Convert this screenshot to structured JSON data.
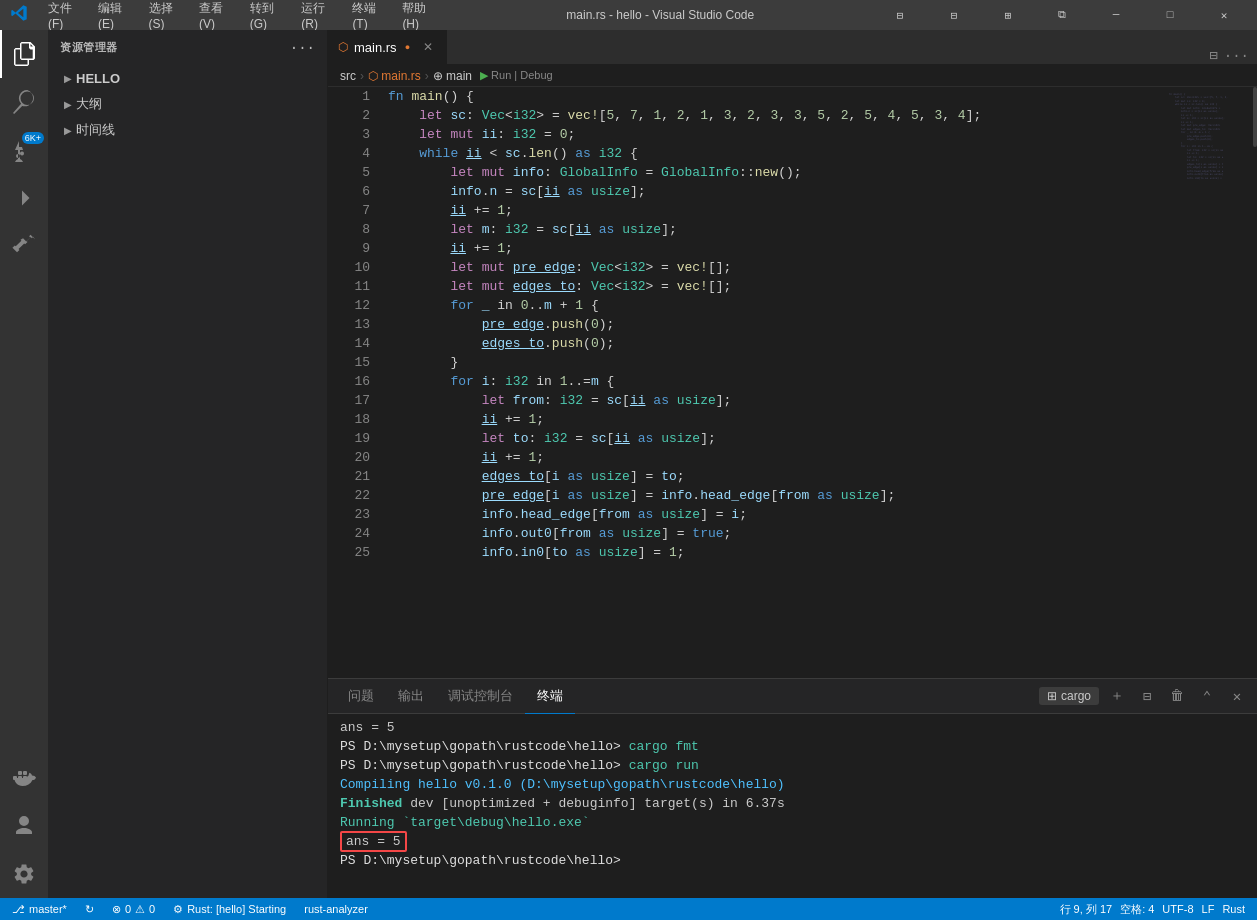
{
  "titlebar": {
    "title": "main.rs - hello - Visual Studio Code",
    "menu": [
      "文件(F)",
      "编辑(E)",
      "选择(S)",
      "查看(V)",
      "转到(G)",
      "运行(R)",
      "终端(T)",
      "帮助(H)"
    ]
  },
  "sidebar": {
    "title": "资源管理器",
    "items": [
      {
        "label": "HELLO",
        "expanded": true
      },
      {
        "label": "大纲",
        "expanded": false
      },
      {
        "label": "时间线",
        "expanded": false
      }
    ]
  },
  "tabs": [
    {
      "label": "main.rs",
      "modified": true,
      "active": true
    }
  ],
  "breadcrumb": {
    "parts": [
      "src",
      "main.rs",
      "main"
    ],
    "runDebug": "Run | Debug"
  },
  "code": {
    "lines": [
      {
        "n": 1,
        "text": "fn main() {"
      },
      {
        "n": 2,
        "text": "    let sc: Vec<i32> = vec![5, 7, 1, 2, 1, 3, 2, 3, 3, 5, 2, 5, 4, 5, 3, 4];"
      },
      {
        "n": 3,
        "text": "    let mut ii: i32 = 0;"
      },
      {
        "n": 4,
        "text": "    while ii < sc.len() as i32 {"
      },
      {
        "n": 5,
        "text": "        let mut info: GlobalInfo = GlobalInfo::new();"
      },
      {
        "n": 6,
        "text": "        info.n = sc[ii as usize];"
      },
      {
        "n": 7,
        "text": "        ii += 1;"
      },
      {
        "n": 8,
        "text": "        let m: i32 = sc[ii as usize];"
      },
      {
        "n": 9,
        "text": "        ii += 1;"
      },
      {
        "n": 10,
        "text": "        let mut pre_edge: Vec<i32> = vec![];"
      },
      {
        "n": 11,
        "text": "        let mut edges_to: Vec<i32> = vec![];"
      },
      {
        "n": 12,
        "text": "        for _ in 0..m + 1 {"
      },
      {
        "n": 13,
        "text": "            pre_edge.push(0);"
      },
      {
        "n": 14,
        "text": "            edges_to.push(0);"
      },
      {
        "n": 15,
        "text": "        }"
      },
      {
        "n": 16,
        "text": "        for i: i32 in 1..=m {"
      },
      {
        "n": 17,
        "text": "            let from: i32 = sc[ii as usize];"
      },
      {
        "n": 18,
        "text": "            ii += 1;"
      },
      {
        "n": 19,
        "text": "            let to: i32 = sc[ii as usize];"
      },
      {
        "n": 20,
        "text": "            ii += 1;"
      },
      {
        "n": 21,
        "text": "            edges_to[i as usize] = to;"
      },
      {
        "n": 22,
        "text": "            pre_edge[i as usize] = info.head_edge[from as usize];"
      },
      {
        "n": 23,
        "text": "            info.head_edge[from as usize] = i;"
      },
      {
        "n": 24,
        "text": "            info.out0[from as usize] = true;"
      },
      {
        "n": 25,
        "text": "            info.in0[to as usize] = 1;"
      }
    ]
  },
  "panel": {
    "tabs": [
      "问题",
      "输出",
      "调试控制台",
      "终端"
    ],
    "active_tab": "终端",
    "cargo_label": "cargo",
    "terminal_lines": [
      {
        "type": "plain",
        "text": "ans = 5"
      },
      {
        "type": "prompt",
        "text": "PS D:\\mysetup\\gopath\\rustcode\\hello> ",
        "cmd": "cargo fmt"
      },
      {
        "type": "prompt",
        "text": "PS D:\\mysetup\\gopath\\rustcode\\hello> ",
        "cmd": "cargo run"
      },
      {
        "type": "compiling",
        "text": "   Compiling hello v0.1.0 (D:\\mysetup\\gopath\\rustcode\\hello)"
      },
      {
        "type": "finished",
        "text": "    Finished dev [unoptimized + debuginfo] target(s) in 6.37s"
      },
      {
        "type": "running",
        "text": "     Running `target\\debug\\hello.exe`"
      },
      {
        "type": "highlight",
        "text": "ans = 5"
      },
      {
        "type": "prompt_cursor",
        "text": "PS D:\\mysetup\\gopath\\rustcode\\hello> "
      }
    ]
  },
  "statusbar": {
    "branch": "master*",
    "sync": "",
    "errors": "0",
    "warnings": "0",
    "rust_info": "Rust: [hello] Starting",
    "analyzer": "rust-analyzer",
    "position": "行 9, 列 17",
    "spaces": "空格: 4",
    "encoding": "UTF-8",
    "line_ending": "LF",
    "language": "Rust"
  }
}
